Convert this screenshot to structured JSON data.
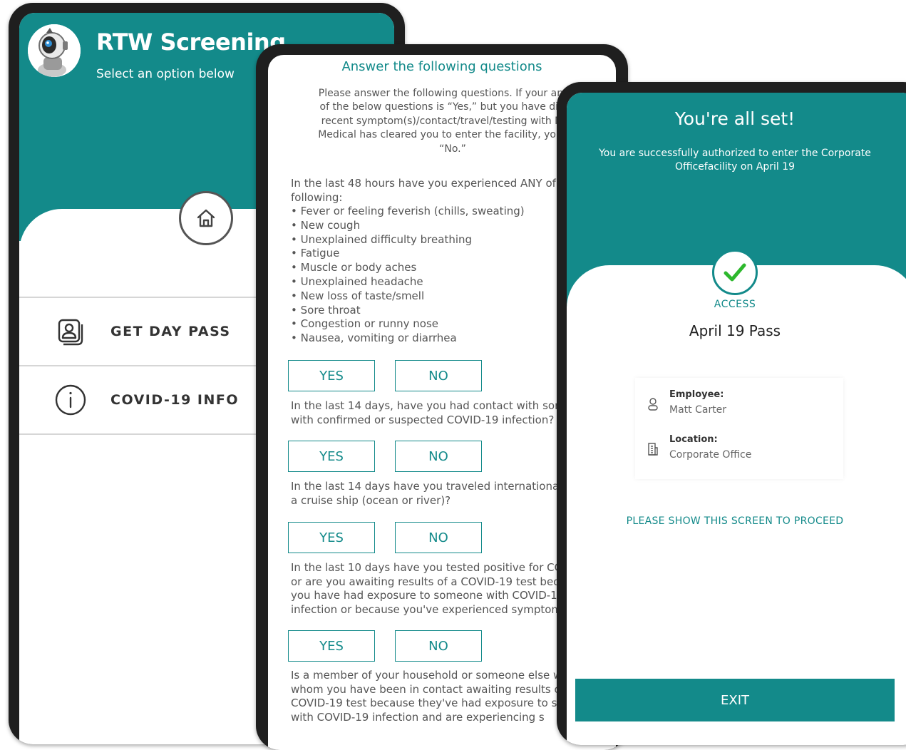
{
  "colors": {
    "teal": "#138a8a",
    "frame": "#1f1f1f",
    "text": "#555555"
  },
  "home_screen": {
    "title": "RTW Screening",
    "subtitle": "Select an option below",
    "menu": [
      {
        "label": "GET DAY PASS",
        "icon": "id-badge-icon"
      },
      {
        "label": "COVID-19 INFO",
        "icon": "info-icon"
      }
    ]
  },
  "questions_screen": {
    "header": "Answer the following questions",
    "intro": "Please answer the following questions. If your answer\nof the below questions is “Yes,” but you have discuss\nrecent symptom(s)/contact/travel/testing with Medic\nMedical has cleared you to enter the facility, you may\n“No.”",
    "questions": [
      {
        "text": "In the last 48 hours have you experienced ANY of t\nfollowing:"
      },
      {
        "text": "In the last 14 days, have you had contact with som\nwith confirmed or suspected COVID-19 infection?"
      },
      {
        "text": "In the last 14 days have you traveled internationall\na cruise ship (ocean or river)?"
      },
      {
        "text": "In the last 10 days have you tested positive for CO\nor are you awaiting results of a COVID-19 test bec\nyou have had exposure to someone with COVID-1\ninfection or because you've experienced symptom"
      },
      {
        "text": "Is a member of your household or someone else w\nwhom you have been in contact awaiting results o\nCOVID-19 test because they've had exposure to so\nwith COVID-19 infection and are experiencing s"
      }
    ],
    "symptoms": [
      "Fever or feeling feverish (chills, sweating)",
      "New cough",
      "Unexplained difficulty breathing",
      "Fatigue",
      "Muscle or body aches",
      "Unexplained headache",
      "New loss of taste/smell",
      "Sore throat",
      "Congestion or runny nose",
      "Nausea, vomiting or diarrhea"
    ],
    "yes_label": "YES",
    "no_label": "NO"
  },
  "pass_screen": {
    "heading": "You're all set!",
    "message": "You are successfully authorized to enter the Corporate\nOfficefacility on April 19",
    "status": "ACCESS",
    "pass_title": "April 19 Pass",
    "employee_label": "Employee:",
    "employee_name": "Matt Carter",
    "location_label": "Location:",
    "location_name": "Corporate Office",
    "instruction": "PLEASE SHOW THIS SCREEN TO PROCEED",
    "exit_label": "EXIT"
  }
}
